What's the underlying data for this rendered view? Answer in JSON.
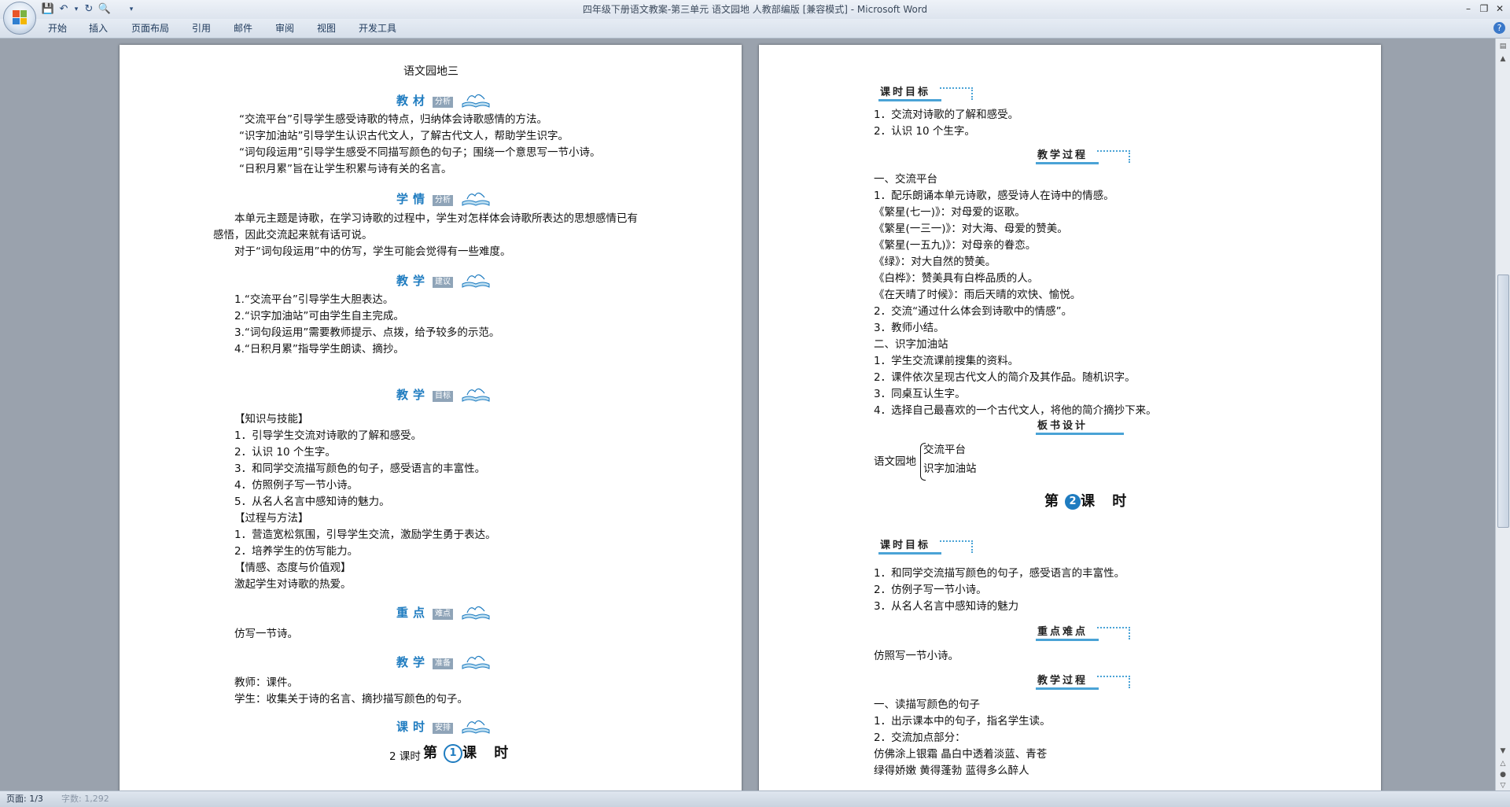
{
  "window": {
    "title": "四年级下册语文教案-第三单元 语文园地 人教部编版 [兼容模式] - Microsoft Word"
  },
  "ribbon": {
    "tabs": [
      "开始",
      "插入",
      "页面布局",
      "引用",
      "邮件",
      "审阅",
      "视图",
      "开发工具"
    ]
  },
  "status": {
    "page": "页面: 1/3",
    "words": "字数: 1,292"
  },
  "page1": {
    "title": "语文园地三",
    "sec1": {
      "h": "教材",
      "sub": "分析"
    },
    "p1": [
      "“交流平台”引导学生感受诗歌的特点，归纳体会诗歌感情的方法。",
      "“识字加油站”引导学生认识古代文人，了解古代文人，帮助学生识字。",
      "“词句段运用”引导学生感受不同描写颜色的句子；围绕一个意思写一节小诗。",
      "“日积月累”旨在让学生积累与诗有关的名言。"
    ],
    "sec2": {
      "h": "学情",
      "sub": "分析"
    },
    "p2": [
      "本单元主题是诗歌，在学习诗歌的过程中，学生对怎样体会诗歌所表达的思想感情已有",
      "感悟，因此交流起来就有话可说。",
      "对于“词句段运用”中的仿写，学生可能会觉得有一些难度。"
    ],
    "sec3": {
      "h": "教学",
      "sub": "建议"
    },
    "p3": [
      "1.“交流平台”引导学生大胆表达。",
      "2.“识字加油站”可由学生自主完成。",
      "3.“词句段运用”需要教师提示、点拨，给予较多的示范。",
      "4.“日积月累”指导学生朗读、摘抄。"
    ],
    "sec4": {
      "h": "教学",
      "sub": "目标"
    },
    "p4": [
      "【知识与技能】",
      "1．引导学生交流对诗歌的了解和感受。",
      "2．认识 10 个生字。",
      "3．和同学交流描写颜色的句子，感受语言的丰富性。",
      "4．仿照例子写一节小诗。",
      "5．从名人名言中感知诗的魅力。",
      "【过程与方法】",
      "1．营造宽松氛围，引导学生交流，激励学生勇于表达。",
      "2．培养学生的仿写能力。",
      "【情感、态度与价值观】",
      "激起学生对诗歌的热爱。"
    ],
    "sec5": {
      "h": "重点",
      "sub": "难点"
    },
    "p5": [
      "仿写一节诗。"
    ],
    "sec6": {
      "h": "教学",
      "sub": "准备"
    },
    "p6": [
      "教师：课件。",
      "学生：收集关于诗的名言、摘抄描写颜色的句子。"
    ],
    "sec7": {
      "h": "课时",
      "sub": "安排"
    },
    "hours": "2 课时",
    "lesson1": {
      "pre": "第",
      "num": "1",
      "post": "课 时"
    }
  },
  "page2": {
    "box1": "课时目标",
    "l1": [
      "1．交流对诗歌的了解和感受。",
      "2．认识 10 个生字。"
    ],
    "box2": "教学过程",
    "l2": [
      "一、交流平台",
      "1．配乐朗诵本单元诗歌，感受诗人在诗中的情感。",
      "《繁星(七一)》：对母爱的讴歌。",
      "《繁星(一三一)》：对大海、母爱的赞美。",
      "《繁星(一五九)》：对母亲的眷恋。",
      "《绿》：对大自然的赞美。",
      "《白桦》：赞美具有白桦品质的人。",
      "《在天晴了时候》：雨后天晴的欢快、愉悦。",
      "2．交流“通过什么体会到诗歌中的情感”。",
      "3．教师小结。",
      "二、识字加油站",
      "1．学生交流课前搜集的资料。",
      "2．课件依次呈现古代文人的简介及其作品。随机识字。",
      "3．同桌互认生字。",
      "4．选择自己最喜欢的一个古代文人，将他的简介摘抄下来。"
    ],
    "box3": "板书设计",
    "board": {
      "root": "语文园地",
      "items": [
        "交流平台",
        "识字加油站"
      ]
    },
    "lesson2": {
      "pre": "第",
      "num": "2",
      "post": "课 时"
    },
    "box4": "课时目标",
    "l4": [
      "1．和同学交流描写颜色的句子，感受语言的丰富性。",
      "2．仿例子写一节小诗。",
      "3．从名人名言中感知诗的魅力"
    ],
    "box5": "重点难点",
    "l5": [
      "仿照写一节小诗。"
    ],
    "box6": "教学过程",
    "l6": [
      "一、读描写颜色的句子",
      "1．出示课本中的句子，指名学生读。",
      "2．交流加点部分：",
      "仿佛涂上银霜   晶白中透着淡蓝、青苍",
      "绿得娇嫩   黄得蓬勃   蓝得多么醉人"
    ]
  }
}
